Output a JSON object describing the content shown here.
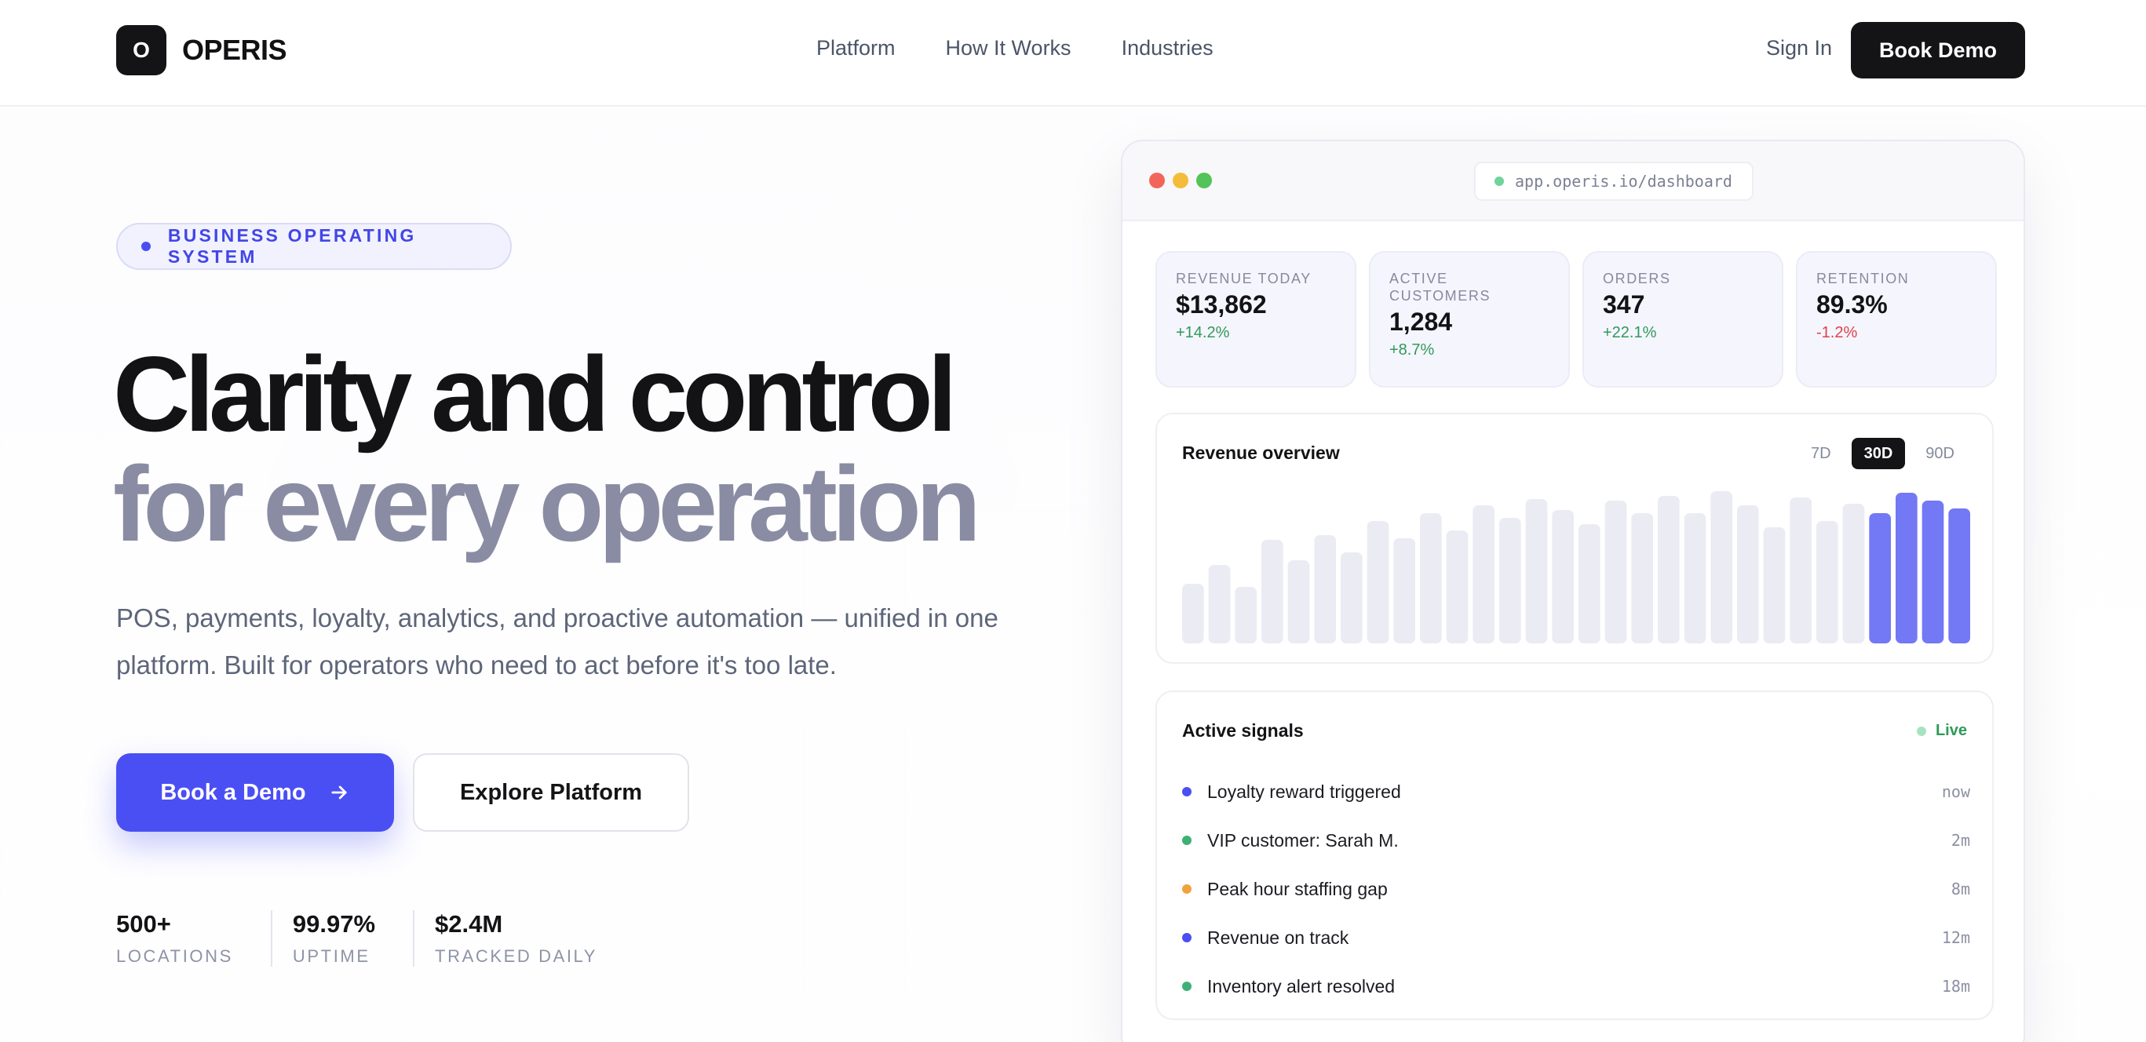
{
  "brand": {
    "mark": "O",
    "name": "OPERIS"
  },
  "nav": {
    "items": [
      "Platform",
      "How It Works",
      "Industries"
    ],
    "sign_in": "Sign In",
    "book_demo": "Book Demo"
  },
  "hero": {
    "badge": "BUSINESS OPERATING SYSTEM",
    "headline_line1": "Clarity and control",
    "headline_line2": "for every operation",
    "subtext": "POS, payments, loyalty, analytics, and proactive automation — unified in one platform. Built for operators who need to act before it's too late.",
    "cta_primary": "Book a Demo",
    "cta_secondary": "Explore Platform",
    "stats": [
      {
        "value": "500+",
        "label": "LOCATIONS"
      },
      {
        "value": "99.97%",
        "label": "UPTIME"
      },
      {
        "value": "$2.4M",
        "label": "TRACKED DAILY"
      }
    ]
  },
  "dashboard": {
    "url": "app.operis.io/dashboard",
    "kpis": [
      {
        "label": "REVENUE TODAY",
        "value": "$13,862",
        "delta": "+14.2%",
        "trend": "up"
      },
      {
        "label": "ACTIVE CUSTOMERS",
        "value": "1,284",
        "delta": "+8.7%",
        "trend": "up"
      },
      {
        "label": "ORDERS",
        "value": "347",
        "delta": "+22.1%",
        "trend": "up"
      },
      {
        "label": "RETENTION",
        "value": "89.3%",
        "delta": "-1.2%",
        "trend": "down"
      }
    ],
    "chart": {
      "title": "Revenue overview",
      "ranges": [
        "7D",
        "30D",
        "90D"
      ],
      "active_range": "30D",
      "colors": {
        "base": "#ebebf3",
        "highlight": "#5b60f2"
      },
      "values": [
        38,
        50,
        36,
        66,
        53,
        69,
        58,
        78,
        67,
        83,
        72,
        88,
        80,
        92,
        85,
        76,
        91,
        83,
        94,
        83,
        97,
        88,
        74,
        93,
        78,
        89,
        83,
        96,
        91,
        86
      ],
      "highlight_from": 26
    },
    "signals": {
      "title": "Active signals",
      "live": "Live",
      "items": [
        {
          "text": "Loyalty reward triggered",
          "time": "now",
          "color": "#4a4ff0"
        },
        {
          "text": "VIP customer: Sarah M.",
          "time": "2m",
          "color": "#3fb074"
        },
        {
          "text": "Peak hour staffing gap",
          "time": "8m",
          "color": "#f0a33a"
        },
        {
          "text": "Revenue on track",
          "time": "12m",
          "color": "#4a4ff0"
        },
        {
          "text": "Inventory alert resolved",
          "time": "18m",
          "color": "#3fb074"
        }
      ]
    }
  }
}
